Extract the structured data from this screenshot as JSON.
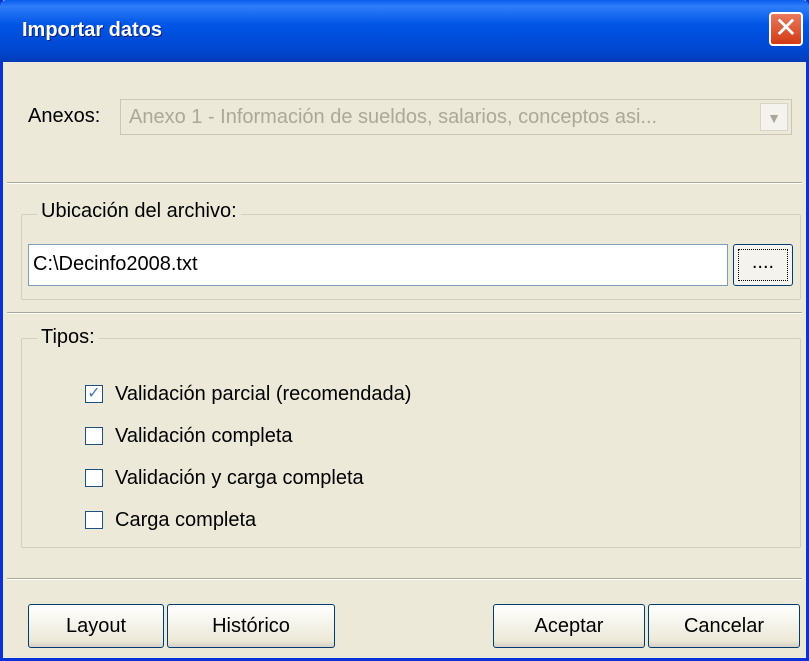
{
  "window": {
    "title": "Importar datos"
  },
  "anexos": {
    "label": "Anexos:",
    "selected": "Anexo 1 - Información de sueldos, salarios, conceptos asi..."
  },
  "ubicacion": {
    "title": "Ubicación del archivo:",
    "path": "C:\\Decinfo2008.txt",
    "browse_label": "...."
  },
  "tipos": {
    "title": "Tipos:",
    "options": [
      {
        "label": "Validación parcial (recomendada)",
        "checked": true
      },
      {
        "label": "Validación completa",
        "checked": false
      },
      {
        "label": "Validación y carga completa",
        "checked": false
      },
      {
        "label": "Carga completa",
        "checked": false
      }
    ]
  },
  "buttons": {
    "layout": "Layout",
    "historico": "Histórico",
    "aceptar": "Aceptar",
    "cancelar": "Cancelar"
  },
  "icons": {
    "close": "close-icon",
    "dropdown": "chevron-down-icon",
    "check": "check-icon"
  }
}
